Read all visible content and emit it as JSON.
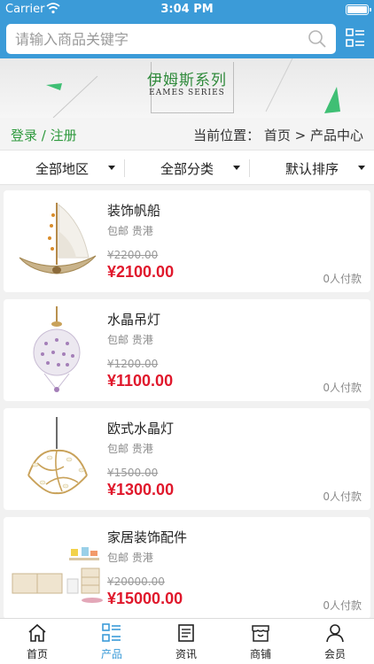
{
  "status": {
    "carrier": "Carrier",
    "time": "3:04 PM"
  },
  "search": {
    "placeholder": "请输入商品关键字"
  },
  "banner": {
    "title": "伊姆斯系列",
    "subtitle": "EAMES SERIES"
  },
  "location": {
    "auth": "登录 / 注册",
    "breadcrumb": "当前位置： 首页 > 产品中心"
  },
  "filters": [
    {
      "label": "全部地区"
    },
    {
      "label": "全部分类"
    },
    {
      "label": "默认排序"
    }
  ],
  "products": [
    {
      "name": "装饰帆船",
      "shipping": "包邮 贵港",
      "old_price": "¥2200.00",
      "price": "¥2100.00",
      "paid": "0人付款",
      "image": "sailboat-ornament"
    },
    {
      "name": "水晶吊灯",
      "shipping": "包邮 贵港",
      "old_price": "¥1200.00",
      "price": "¥1100.00",
      "paid": "0人付款",
      "image": "crystal-chandelier"
    },
    {
      "name": "欧式水晶灯",
      "shipping": "包邮 贵港",
      "old_price": "¥1500.00",
      "price": "¥1300.00",
      "paid": "0人付款",
      "image": "branch-pendant-lamp"
    },
    {
      "name": "家居装饰配件",
      "shipping": "包邮 贵港",
      "old_price": "¥20000.00",
      "price": "¥15000.00",
      "paid": "0人付款",
      "image": "living-room-furniture"
    }
  ],
  "tabs": [
    {
      "label": "首页",
      "icon": "home-icon",
      "active": false
    },
    {
      "label": "产品",
      "icon": "grid-list-icon",
      "active": true
    },
    {
      "label": "资讯",
      "icon": "news-icon",
      "active": false
    },
    {
      "label": "商铺",
      "icon": "shop-icon",
      "active": false
    },
    {
      "label": "会员",
      "icon": "user-icon",
      "active": false
    }
  ],
  "colors": {
    "header": "#3b9bd8",
    "accent_green": "#2f9a3e",
    "price_red": "#e0182c"
  }
}
